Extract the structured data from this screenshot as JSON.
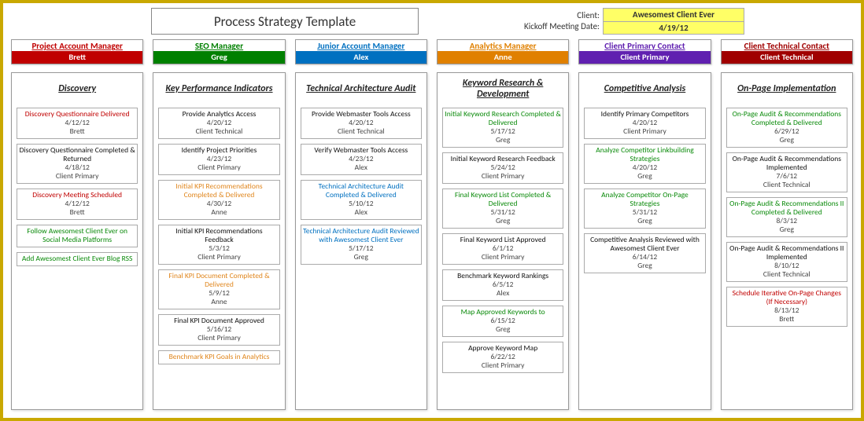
{
  "header": {
    "title": "Process Strategy Template",
    "labels": {
      "client": "Client:",
      "kickoff": "Kickoff Meeting Date:"
    },
    "client": "Awesomest Client Ever",
    "kickoff": "4/19/12"
  },
  "roles": [
    {
      "title": "Project Account Manager",
      "name": "Brett",
      "color": "red"
    },
    {
      "title": "SEO Manager",
      "name": "Greg",
      "color": "green"
    },
    {
      "title": "Junior Account Manager",
      "name": "Alex",
      "color": "blue"
    },
    {
      "title": "Analytics Manager",
      "name": "Anne",
      "color": "orange"
    },
    {
      "title": "Client Primary Contact",
      "name": "Client Primary",
      "color": "purple"
    },
    {
      "title": "Client Technical Contact",
      "name": "Client Technical",
      "color": "dred"
    }
  ],
  "columns": [
    {
      "heading": "Discovery",
      "tasks": [
        {
          "title": "Discovery Questionnaire Delivered",
          "date": "4/12/12",
          "owner": "Brett",
          "color": "red"
        },
        {
          "title": "Discovery Questionnaire Completed & Returned",
          "date": "4/18/12",
          "owner": "Client Primary",
          "color": "black"
        },
        {
          "title": "Discovery Meeting Scheduled",
          "date": "4/12/12",
          "owner": "Brett",
          "color": "red"
        },
        {
          "title": "Follow Awesomest Client Ever on Social Media Platforms",
          "date": "",
          "owner": "",
          "color": "green"
        },
        {
          "title": "Add Awesomest Client Ever Blog RSS",
          "date": "",
          "owner": "",
          "color": "green"
        }
      ]
    },
    {
      "heading": "Key Performance Indicators",
      "tasks": [
        {
          "title": "Provide Analytics Access",
          "date": "4/20/12",
          "owner": "Client Technical",
          "color": "black"
        },
        {
          "title": "Identify Project Priorities",
          "date": "4/23/12",
          "owner": "Client Primary",
          "color": "black"
        },
        {
          "title": "Initial KPI Recommendations Completed & Delivered",
          "date": "4/30/12",
          "owner": "Anne",
          "color": "orange"
        },
        {
          "title": "Initial KPI Recommendations Feedback",
          "date": "5/3/12",
          "owner": "Client Primary",
          "color": "black"
        },
        {
          "title": "Final KPI Document Completed & Delivered",
          "date": "5/9/12",
          "owner": "Anne",
          "color": "orange"
        },
        {
          "title": "Final KPI Document Approved",
          "date": "5/16/12",
          "owner": "Client Primary",
          "color": "black"
        },
        {
          "title": "Benchmark KPI Goals in Analytics",
          "date": "",
          "owner": "",
          "color": "orange"
        }
      ]
    },
    {
      "heading": "Technical Architecture Audit",
      "tasks": [
        {
          "title": "Provide Webmaster Tools Access",
          "date": "4/20/12",
          "owner": "Client Technical",
          "color": "black"
        },
        {
          "title": "Verify Webmaster Tools Access",
          "date": "4/23/12",
          "owner": "Alex",
          "color": "black"
        },
        {
          "title": "Technical Architecture Audit Completed & Delivered",
          "date": "5/10/12",
          "owner": "Alex",
          "color": "blue"
        },
        {
          "title": "Technical Architecture Audit Reviewed with Awesomest Client Ever",
          "date": "5/17/12",
          "owner": "Greg",
          "color": "blue"
        }
      ]
    },
    {
      "heading": "Keyword Research & Development",
      "tasks": [
        {
          "title": "Initial Keyword Research Completed & Delivered",
          "date": "5/17/12",
          "owner": "Greg",
          "color": "green"
        },
        {
          "title": "Initial Keyword Research Feedback",
          "date": "5/24/12",
          "owner": "Client Primary",
          "color": "black"
        },
        {
          "title": "Final Keyword List Completed & Delivered",
          "date": "5/31/12",
          "owner": "Greg",
          "color": "green"
        },
        {
          "title": "Final Keyword List Approved",
          "date": "6/1/12",
          "owner": "Client Primary",
          "color": "black"
        },
        {
          "title": "Benchmark Keyword Rankings",
          "date": "6/5/12",
          "owner": "Alex",
          "color": "black"
        },
        {
          "title": "Map Approved Keywords to",
          "date": "6/15/12",
          "owner": "Greg",
          "color": "green"
        },
        {
          "title": "Approve Keyword Map",
          "date": "6/22/12",
          "owner": "Client Primary",
          "color": "black"
        }
      ]
    },
    {
      "heading": "Competitive Analysis",
      "tasks": [
        {
          "title": "Identify Primary Competitors",
          "date": "4/20/12",
          "owner": "Client Primary",
          "color": "black"
        },
        {
          "title": "Analyze Competitor Linkbuilding Strategies",
          "date": "4/20/12",
          "owner": "Greg",
          "color": "green"
        },
        {
          "title": "Analyze Competitor On-Page Strategies",
          "date": "5/31/12",
          "owner": "Greg",
          "color": "green"
        },
        {
          "title": "Competitive Analysis Reviewed with Awesomest Client Ever",
          "date": "6/14/12",
          "owner": "Greg",
          "color": "black"
        }
      ]
    },
    {
      "heading": "On-Page Implementation",
      "tasks": [
        {
          "title": "On-Page Audit & Recommendations Completed & Delivered",
          "date": "6/29/12",
          "owner": "Greg",
          "color": "green"
        },
        {
          "title": "On-Page Audit & Recommendations Implemented",
          "date": "7/6/12",
          "owner": "Client Technical",
          "color": "black"
        },
        {
          "title": "On-Page Audit & Recommendations II Completed & Delivered",
          "date": "8/3/12",
          "owner": "Greg",
          "color": "green"
        },
        {
          "title": "On-Page Audit & Recommendations II Implemented",
          "date": "8/10/12",
          "owner": "Client Technical",
          "color": "black"
        },
        {
          "title": "Schedule Iterative On-Page Changes (If Necessary)",
          "date": "8/13/12",
          "owner": "Brett",
          "color": "red"
        }
      ]
    }
  ]
}
